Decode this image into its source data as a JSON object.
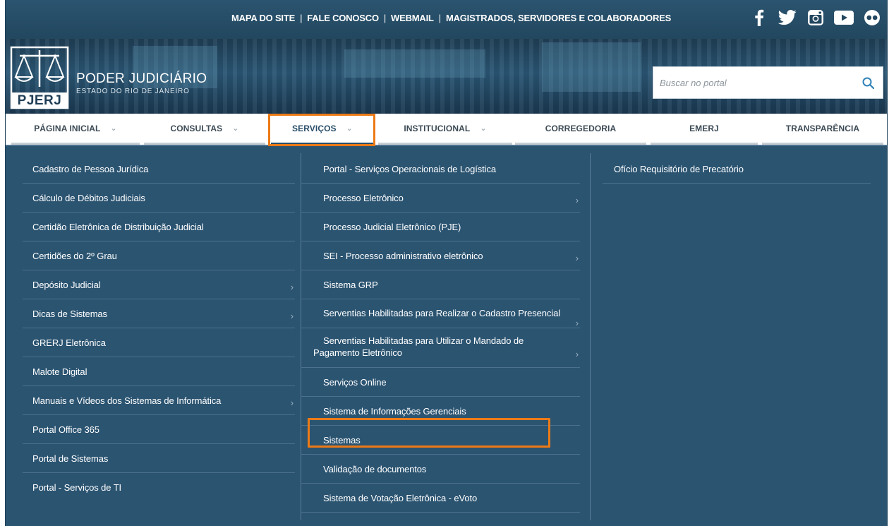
{
  "topbar": {
    "links": [
      "MAPA DO SITE",
      "FALE CONOSCO",
      "WEBMAIL",
      "MAGISTRADOS, SERVIDORES E COLABORADORES"
    ],
    "separator": "|",
    "social": [
      "facebook-icon",
      "twitter-icon",
      "instagram-icon",
      "youtube-icon",
      "flickr-icon"
    ]
  },
  "brand": {
    "logo_letters": "PJERJ",
    "title": "PODER JUDICIÁRIO",
    "subtitle": "ESTADO DO RIO DE JANEIRO"
  },
  "search": {
    "placeholder": "Buscar no portal",
    "value": ""
  },
  "nav": {
    "items": [
      {
        "label": "PÁGINA INICIAL",
        "has_chevron": true
      },
      {
        "label": "CONSULTAS",
        "has_chevron": true
      },
      {
        "label": "SERVIÇOS",
        "has_chevron": true
      },
      {
        "label": "INSTITUCIONAL",
        "has_chevron": true
      },
      {
        "label": "CORREGEDORIA",
        "has_chevron": false
      },
      {
        "label": "EMERJ",
        "has_chevron": false
      },
      {
        "label": "TRANSPARÊNCIA",
        "has_chevron": false
      }
    ],
    "chevron": "⌄",
    "active": "SERVIÇOS"
  },
  "menu": {
    "arrow": "›",
    "col1": [
      {
        "label": "Cadastro de Pessoa Jurídica",
        "submenu": false
      },
      {
        "label": "Cálculo de Débitos Judiciais",
        "submenu": false
      },
      {
        "label": "Certidão Eletrônica de Distribuição Judicial",
        "submenu": false
      },
      {
        "label": "Certidões do 2º Grau",
        "submenu": false
      },
      {
        "label": "Depósito Judicial",
        "submenu": true
      },
      {
        "label": "Dicas de Sistemas",
        "submenu": true
      },
      {
        "label": "GRERJ Eletrônica",
        "submenu": false
      },
      {
        "label": "Malote Digital",
        "submenu": false
      },
      {
        "label": "Manuais e Vídeos dos Sistemas de Informática",
        "submenu": true
      },
      {
        "label": "Portal Office 365",
        "submenu": false
      },
      {
        "label": "Portal de Sistemas",
        "submenu": false
      },
      {
        "label": "Portal - Serviços de TI",
        "submenu": false
      }
    ],
    "col2": [
      {
        "label": "Portal - Serviços Operacionais de Logística",
        "submenu": false
      },
      {
        "label": "Processo Eletrônico",
        "submenu": true
      },
      {
        "label": "Processo Judicial Eletrônico (PJE)",
        "submenu": false
      },
      {
        "label": "SEI - Processo administrativo eletrônico",
        "submenu": true
      },
      {
        "label": "Sistema GRP",
        "submenu": false
      },
      {
        "label": "Serventias Habilitadas para Realizar o Cadastro Presencial",
        "submenu": true
      },
      {
        "label": "Serventias Habilitadas para Utilizar o Mandado de Pagamento Eletrônico",
        "submenu": true
      },
      {
        "label": "Serviços Online",
        "submenu": false
      },
      {
        "label": "Sistema de Informações Gerenciais",
        "submenu": false
      },
      {
        "label": "Sistemas",
        "submenu": false
      },
      {
        "label": "Validação de documentos",
        "submenu": false
      },
      {
        "label": "Sistema de Votação Eletrônica - eVoto",
        "submenu": false
      }
    ],
    "col3": [
      {
        "label": "Ofício Requisitório de Precatório",
        "submenu": false
      }
    ]
  },
  "colors": {
    "accent_highlight": "#ec7a16",
    "panel_bg": "#2b5471",
    "topbar_bg": "#22475f"
  }
}
